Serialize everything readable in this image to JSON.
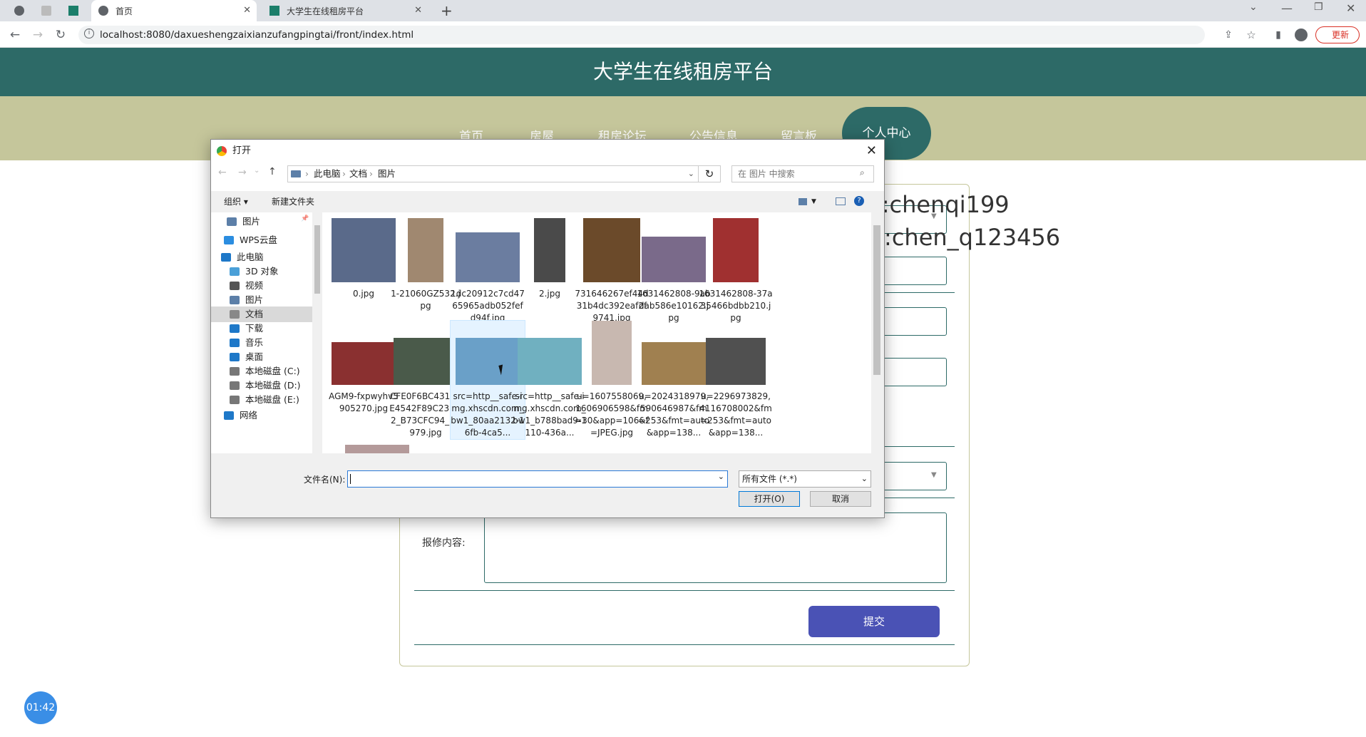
{
  "browser": {
    "tabs": [
      {
        "label": ""
      },
      {
        "label": ""
      },
      {
        "label": ""
      },
      {
        "label": "首页"
      },
      {
        "label": "大学生在线租房平台"
      }
    ],
    "url": "localhost:8080/daxueshengzaixianzufangpingtai/front/index.html",
    "update_label": "更新"
  },
  "site": {
    "title": "大学生在线租房平台",
    "nav": [
      {
        "label": "首页"
      },
      {
        "label": "房屋"
      },
      {
        "label": "租房论坛"
      },
      {
        "label": "公告信息"
      },
      {
        "label": "留言板"
      },
      {
        "label": "个人中心"
      }
    ],
    "repair_label": "报修内容:",
    "submit_label": "提交",
    "watermark_line1": "git:chenqi199",
    "watermark_line2": "v x:chen_q123456",
    "timer": "01:42"
  },
  "dialog": {
    "title": "打开",
    "breadcrumb": [
      "此电脑",
      "文档",
      "图片"
    ],
    "search_placeholder": "在 图片 中搜索",
    "organize_label": "组织 ▾",
    "new_folder_label": "新建文件夹",
    "tree": [
      {
        "label": "图片",
        "icon": "pictures-folder-icon"
      },
      {
        "label": "WPS云盘",
        "icon": "cloud-icon"
      },
      {
        "label": "此电脑",
        "icon": "computer-icon"
      },
      {
        "label": "3D 对象",
        "icon": "3d-objects-icon"
      },
      {
        "label": "视频",
        "icon": "videos-icon"
      },
      {
        "label": "图片",
        "icon": "pictures-folder-icon"
      },
      {
        "label": "文档",
        "icon": "documents-icon"
      },
      {
        "label": "下载",
        "icon": "downloads-icon"
      },
      {
        "label": "音乐",
        "icon": "music-icon"
      },
      {
        "label": "桌面",
        "icon": "desktop-icon"
      },
      {
        "label": "本地磁盘 (C:)",
        "icon": "drive-icon"
      },
      {
        "label": "本地磁盘 (D:)",
        "icon": "drive-icon"
      },
      {
        "label": "本地磁盘 (E:)",
        "icon": "drive-icon"
      },
      {
        "label": "网络",
        "icon": "network-icon"
      }
    ],
    "files": [
      {
        "name": "0.jpg"
      },
      {
        "name": "1-21060GZ532.jpg"
      },
      {
        "name": "1dc20912c7cd4765965adb052fefd94f.jpg"
      },
      {
        "name": "2.jpg"
      },
      {
        "name": "731646267ef44d31b4dc392eaf2f9741.jpg"
      },
      {
        "name": "1631462808-9abdab586e10162.jpg"
      },
      {
        "name": "1631462808-37a35466bdbb210.jpg"
      },
      {
        "name": "AGM9-fxpwyhv5905270.jpg"
      },
      {
        "name": "CFE0F6BC4313AE4542F89C23DC2_B73CFC94_2B979.jpg"
      },
      {
        "name": "src=http__safe-img.xhscdn.com_bw1_80aa2132-16fb-4ca5..."
      },
      {
        "name": "src=http__safe-img.xhscdn.com_bw1_b788bad9-1110-436a..."
      },
      {
        "name": "u=1607558069,1606906598&fm=30&app=106&f=JPEG.jpg"
      },
      {
        "name": "u=2024318979,590646987&fm=253&fmt=auto&app=138..."
      },
      {
        "name": "u=2296973829,4116708002&fm=253&fmt=auto&app=138..."
      }
    ],
    "filename_label": "文件名(N):",
    "filename_value": "",
    "filetype": "所有文件 (*.*)",
    "open_label": "打开(O)",
    "cancel_label": "取消",
    "thumb_colors": [
      "#5a6a8a",
      "#a08870",
      "#6b7da0",
      "#4a4a4a",
      "#6b4a2a",
      "#7a6a8a",
      "#a03030",
      "#8a3030",
      "#4a5a4a",
      "#6aa0c8",
      "#70b0c0",
      "#c8b8b0",
      "#a08050",
      "#505050"
    ]
  }
}
